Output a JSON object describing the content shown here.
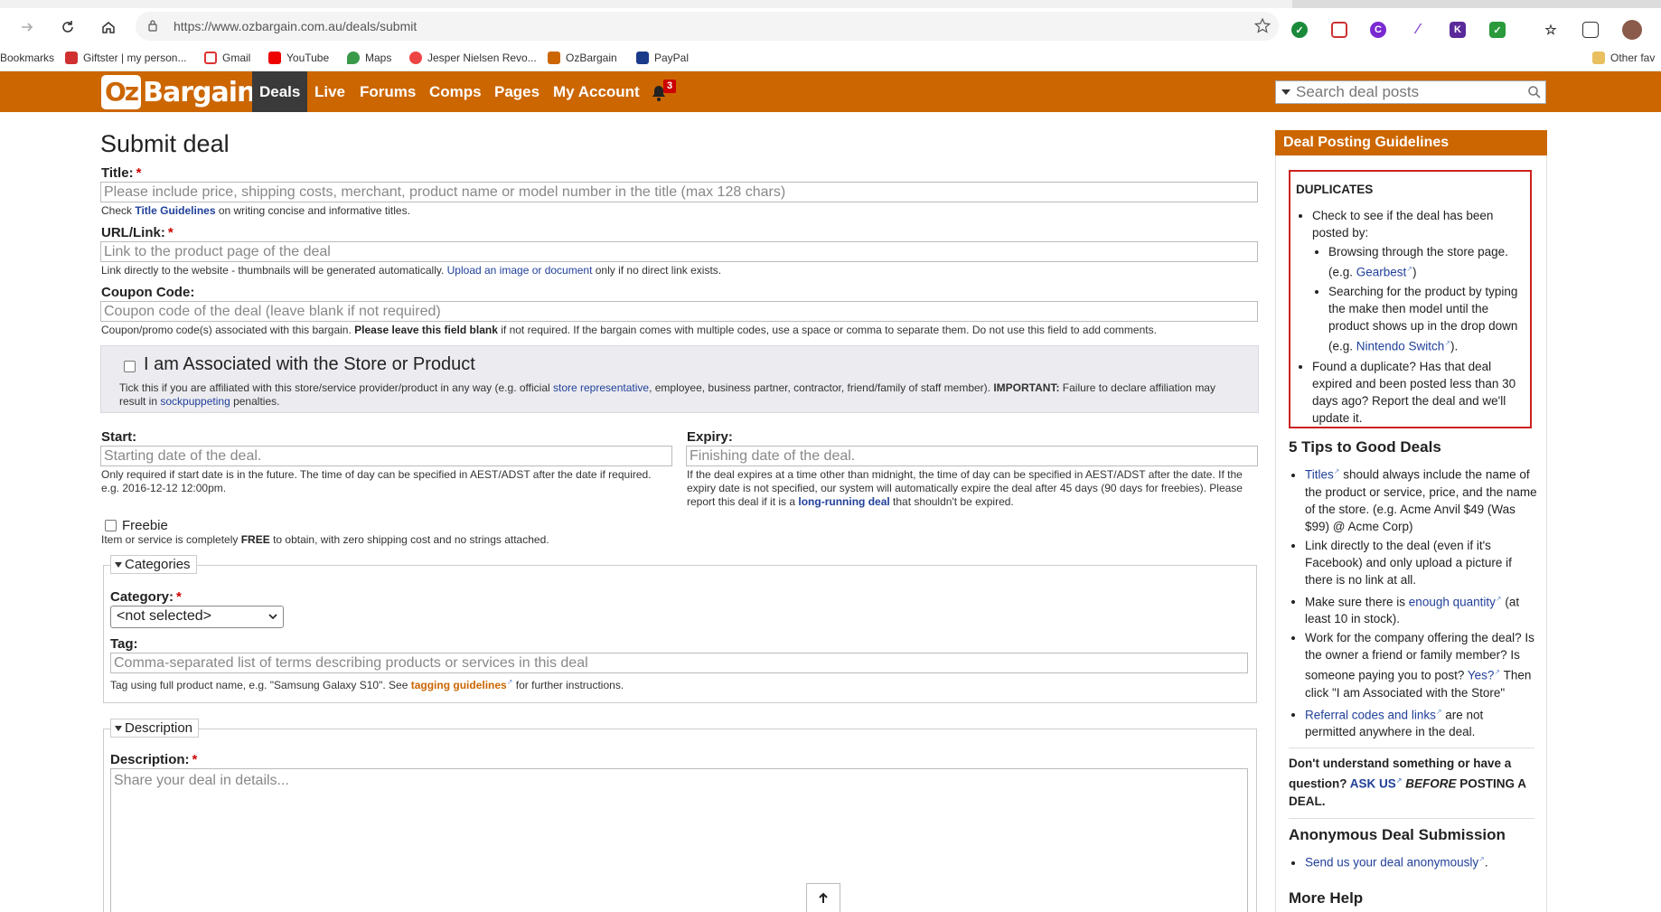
{
  "browser": {
    "url": "https://www.ozbargain.com.au/deals/submit",
    "bookmarks": [
      {
        "label": "Bookmarks"
      },
      {
        "label": "Giftster | my person..."
      },
      {
        "label": "Gmail"
      },
      {
        "label": "YouTube"
      },
      {
        "label": "Maps"
      },
      {
        "label": "Jesper Nielsen Revo..."
      },
      {
        "label": "OzBargain"
      },
      {
        "label": "PayPal"
      },
      {
        "label": "Other fav"
      }
    ]
  },
  "site": {
    "logo_oz": "Oz",
    "logo_bargain": "Bargain",
    "nav": [
      "Deals",
      "Live",
      "Forums",
      "Comps",
      "Pages",
      "My Account"
    ],
    "notification_count": "3",
    "search_placeholder": "Search deal posts"
  },
  "form": {
    "heading": "Submit deal",
    "title_label": "Title:",
    "title_placeholder": "Please include price, shipping costs, merchant, product name or model number in the title (max 128 chars)",
    "title_help_pre": "Check ",
    "title_help_link": "Title Guidelines",
    "title_help_post": " on writing concise and informative titles.",
    "url_label": "URL/Link:",
    "url_placeholder": "Link to the product page of the deal",
    "url_help_pre": "Link directly to the website - thumbnails will be generated automatically. ",
    "url_help_link": "Upload an image or document",
    "url_help_post": " only if no direct link exists.",
    "coupon_label": "Coupon Code:",
    "coupon_placeholder": "Coupon code of the deal (leave blank if not required)",
    "coupon_help_pre": "Coupon/promo code(s) associated with this bargain. ",
    "coupon_help_bold": "Please leave this field blank",
    "coupon_help_post": " if not required. If the bargain comes with multiple codes, use a space or comma to separate them. Do not use this field to add comments.",
    "assoc_title": "I am Associated with the Store or Product",
    "assoc_desc_1": "Tick this if you are affiliated with this store/service provider/product in any way (e.g. official ",
    "assoc_desc_link1": "store representative",
    "assoc_desc_2": ", employee, business partner, contractor, friend/family of staff member). ",
    "assoc_desc_bold": "IMPORTANT:",
    "assoc_desc_3": " Failure to declare affiliation may result in ",
    "assoc_desc_link2": "sockpuppeting",
    "assoc_desc_4": " penalties.",
    "start_label": "Start:",
    "start_placeholder": "Starting date of the deal.",
    "start_help": "Only required if start date is in the future. The time of day can be specified in AEST/ADST after the date if required. e.g. 2016-12-12 12:00pm.",
    "expiry_label": "Expiry:",
    "expiry_placeholder": "Finishing date of the deal.",
    "expiry_help_pre": "If the deal expires at a time other than midnight, the time of day can be specified in AEST/ADST after the date. If the expiry date is not specified, our system will automatically expire the deal after 45 days (90 days for freebies). Please report this deal if it is a ",
    "expiry_help_link": "long-running deal",
    "expiry_help_post": " that shouldn't be expired.",
    "freebie_label": "Freebie",
    "freebie_help_pre": "Item or service is completely ",
    "freebie_help_bold": "FREE",
    "freebie_help_post": " to obtain, with zero shipping cost and no strings attached.",
    "categories_legend": "Categories",
    "category_label": "Category:",
    "category_selected": "<not selected>",
    "tag_label": "Tag:",
    "tag_placeholder": "Comma-separated list of terms describing products or services in this deal",
    "tag_help_pre": "Tag using full product name, e.g. \"Samsung Galaxy S10\". See ",
    "tag_help_link": "tagging guidelines",
    "tag_help_post": " for further instructions.",
    "description_legend": "Description",
    "description_label": "Description:",
    "description_placeholder": "Share your deal in details..."
  },
  "sidebar": {
    "header": "Deal Posting Guidelines",
    "duplicates": {
      "heading": "DUPLICATES",
      "item1": "Check to see if the deal has been posted by:",
      "sub1_pre": "Browsing through the store page. (e.g. ",
      "sub1_link": "Gearbest",
      "sub1_post": ")",
      "sub2_pre": "Searching for the product by typing the make then model until the product shows up in the drop down (e.g. ",
      "sub2_link": "Nintendo Switch",
      "sub2_post": ").",
      "item2": "Found a duplicate? Has that deal expired and been posted less than 30 days ago? Report the deal and we'll update it."
    },
    "tips": {
      "heading": "5 Tips to Good Deals",
      "t1_link": "Titles",
      "t1_post": " should always include the name of the product or service, price, and the name of the store. (e.g. Acme Anvil $49 (Was $99) @ Acme Corp)",
      "t2": "Link directly to the deal (even if it's Facebook) and only upload a picture if there is no link at all.",
      "t3_pre": "Make sure there is ",
      "t3_link": "enough quantity",
      "t3_post": " (at least 10 in stock).",
      "t4_pre": "Work for the company offering the deal? Is the owner a friend or family member? Is someone paying you to post? ",
      "t4_link": "Yes?",
      "t4_post": " Then click \"I am Associated with the Store\"",
      "t5_link": "Referral codes and links",
      "t5_post": " are not permitted anywhere in the deal."
    },
    "question_pre": "Don't understand something or have a question? ",
    "question_link": "ASK US",
    "question_italic": " BEFORE",
    "question_post": " POSTING A DEAL.",
    "anon_heading": "Anonymous Deal Submission",
    "anon_link": "Send us your deal anonymously",
    "anon_post": ".",
    "more_help_heading": "More Help"
  },
  "colors": {
    "brand_orange": "#cc6600",
    "nav_active": "#3a3a3a",
    "link": "#21409a",
    "dup_border": "#cc2222",
    "tag_link": "#cc6600"
  }
}
